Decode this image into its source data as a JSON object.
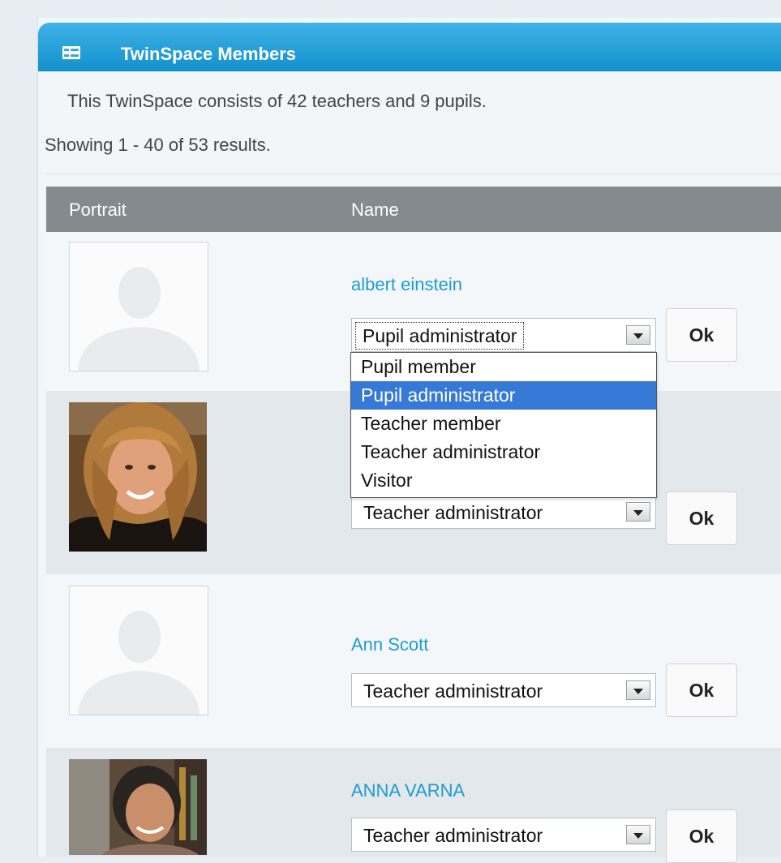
{
  "panel": {
    "title": "TwinSpace Members",
    "summary": "This TwinSpace consists of 42 teachers and 9 pupils.",
    "showing": "Showing 1 - 40 of 53 results."
  },
  "table": {
    "columns": [
      "Portrait",
      "Name"
    ],
    "members": [
      {
        "name": "albert einstein",
        "role": "Pupil administrator",
        "portrait": "placeholder-silhouette",
        "ok_label": "Ok"
      },
      {
        "name": "",
        "role": "Teacher administrator",
        "portrait": "photo-woman-blonde",
        "ok_label": "Ok"
      },
      {
        "name": "Ann Scott",
        "role": "Teacher administrator",
        "portrait": "placeholder-silhouette",
        "ok_label": "Ok"
      },
      {
        "name": "ANNA VARNA",
        "role": "Teacher administrator",
        "portrait": "photo-woman-dark-hair",
        "ok_label": "Ok"
      }
    ]
  },
  "dropdown": {
    "options": [
      "Pupil member",
      "Pupil administrator",
      "Teacher member",
      "Teacher administrator",
      "Visitor"
    ],
    "selected": "Pupil administrator"
  },
  "colors": {
    "header_blue": "#1f9ad6",
    "link_blue": "#1f9bd0",
    "table_header_gray": "#838b8e",
    "selection_blue": "#3779d6"
  }
}
